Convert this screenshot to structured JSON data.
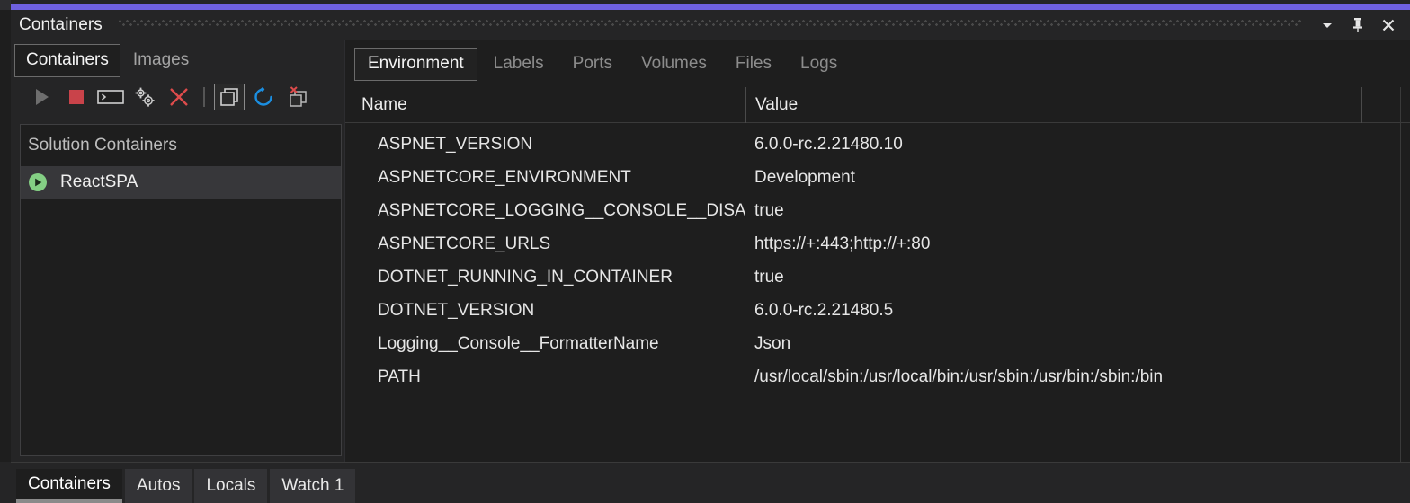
{
  "theme": {
    "accent": "#6f61e0",
    "background": "#1e1e1e",
    "chrome": "#252526",
    "selection": "#37373a",
    "text": "#e6e6e6",
    "muted": "#8c8c8c",
    "running_green": "#7bd47b",
    "stop_red": "#c9434a",
    "refresh_blue": "#1b8ee0",
    "delete_red": "#e05252"
  },
  "titlebar": {
    "title": "Containers",
    "buttons": [
      {
        "name": "window-options-dropdown",
        "icon": "chevron-down-icon"
      },
      {
        "name": "pin-window-button",
        "icon": "pin-icon"
      },
      {
        "name": "close-window-button",
        "icon": "close-icon"
      }
    ]
  },
  "left_pane": {
    "tabs": [
      {
        "label": "Containers",
        "active": true
      },
      {
        "label": "Images",
        "active": false
      }
    ],
    "toolbar": [
      {
        "name": "start-container-button",
        "icon": "play-icon",
        "enabled": false
      },
      {
        "name": "stop-container-button",
        "icon": "stop-icon",
        "enabled": true
      },
      {
        "name": "open-terminal-button",
        "icon": "terminal-icon",
        "enabled": true
      },
      {
        "name": "attach-debugger-button",
        "icon": "gears-icon",
        "enabled": true
      },
      {
        "name": "remove-container-button",
        "icon": "close-x-icon",
        "enabled": true
      },
      {
        "name": "separator",
        "icon": "separator",
        "enabled": false
      },
      {
        "name": "view-containers-button",
        "icon": "windows-icon",
        "enabled": true,
        "selected": true
      },
      {
        "name": "refresh-button",
        "icon": "refresh-icon",
        "enabled": true
      },
      {
        "name": "prune-containers-button",
        "icon": "windows-remove-icon",
        "enabled": true
      }
    ],
    "tree": {
      "group_label": "Solution Containers",
      "items": [
        {
          "label": "ReactSPA",
          "status_icon": "running-icon",
          "selected": true
        }
      ]
    }
  },
  "right_pane": {
    "tabs": [
      {
        "label": "Environment",
        "active": true
      },
      {
        "label": "Labels",
        "active": false
      },
      {
        "label": "Ports",
        "active": false
      },
      {
        "label": "Volumes",
        "active": false
      },
      {
        "label": "Files",
        "active": false
      },
      {
        "label": "Logs",
        "active": false
      }
    ],
    "grid": {
      "columns": [
        "Name",
        "Value"
      ],
      "rows": [
        {
          "name": "ASPNET_VERSION",
          "value": "6.0.0-rc.2.21480.10"
        },
        {
          "name": "ASPNETCORE_ENVIRONMENT",
          "value": "Development"
        },
        {
          "name": "ASPNETCORE_LOGGING__CONSOLE__DISA...",
          "value": "true"
        },
        {
          "name": "ASPNETCORE_URLS",
          "value": "https://+:443;http://+:80"
        },
        {
          "name": "DOTNET_RUNNING_IN_CONTAINER",
          "value": "true"
        },
        {
          "name": "DOTNET_VERSION",
          "value": "6.0.0-rc.2.21480.5"
        },
        {
          "name": "Logging__Console__FormatterName",
          "value": "Json"
        },
        {
          "name": "PATH",
          "value": "/usr/local/sbin:/usr/local/bin:/usr/sbin:/usr/bin:/sbin:/bin"
        }
      ]
    }
  },
  "bottom_tabs": [
    {
      "label": "Containers",
      "active": true
    },
    {
      "label": "Autos",
      "active": false
    },
    {
      "label": "Locals",
      "active": false
    },
    {
      "label": "Watch 1",
      "active": false
    }
  ]
}
